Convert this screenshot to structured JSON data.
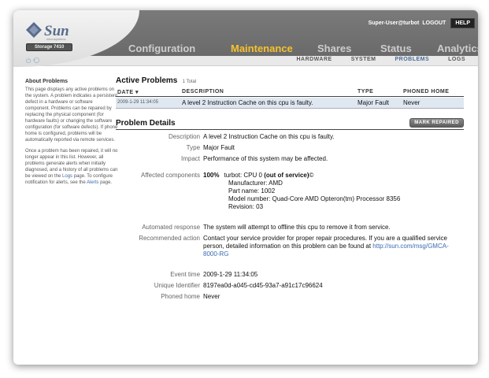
{
  "brand": {
    "logo_text": "Sun",
    "logo_subtext": "microsystems",
    "product": "Storage 7410"
  },
  "header": {
    "user": "Super-User@turbot",
    "logout": "LOGOUT",
    "help": "HELP",
    "status_icons": "⏻ ⟲"
  },
  "main_tabs": [
    {
      "label": "Configuration",
      "active": false
    },
    {
      "label": "Maintenance",
      "active": true
    },
    {
      "label": "Shares",
      "active": false
    },
    {
      "label": "Status",
      "active": false
    },
    {
      "label": "Analytics",
      "active": false
    }
  ],
  "sub_tabs": [
    {
      "label": "HARDWARE",
      "active": false
    },
    {
      "label": "SYSTEM",
      "active": false
    },
    {
      "label": "PROBLEMS",
      "active": true
    },
    {
      "label": "LOGS",
      "active": false
    }
  ],
  "sidebar": {
    "title": "About Problems",
    "p1": "This page displays any active problems on the system. A problem indicates a persistent defect in a hardware or software component. Problems can be repaired by replacing the physical component (for hardware faults) or changing the software configuration (for software defects). If phone home is configured, problems will be automatically reported via remote services.",
    "p2_a": "Once a problem has been repaired, it will no longer appear in this list. However, all problems generate alerts when initially diagnosed, and a history of all problems can be viewed on the",
    "p2_logs": "Logs",
    "p2_b": "page. To configure notification for alerts, see the",
    "p2_alerts": "Alerts",
    "p2_c": "page."
  },
  "active_problems": {
    "title": "Active Problems",
    "total": "1 Total",
    "columns": {
      "date": "DATE ▾",
      "description": "DESCRIPTION",
      "type": "TYPE",
      "phoned_home": "PHONED HOME"
    },
    "rows": [
      {
        "date": "2009-1-29 11:34:05",
        "description": "A level 2 Instruction Cache on this cpu is faulty.",
        "type": "Major Fault",
        "phoned_home": "Never"
      }
    ]
  },
  "details": {
    "title": "Problem Details",
    "mark_repaired": "MARK REPAIRED",
    "labels": {
      "description": "Description",
      "type": "Type",
      "impact": "Impact",
      "affected": "Affected components",
      "automated": "Automated response",
      "recommended": "Recommended action",
      "event_time": "Event time",
      "uid": "Unique Identifier",
      "phoned_home": "Phoned home"
    },
    "description": "A level 2 Instruction Cache on this cpu is faulty.",
    "type": "Major Fault",
    "impact": "Performance of this system may be affected.",
    "affected": {
      "percent": "100%",
      "component": "turbot: CPU 0",
      "status": "(out of service)",
      "manufacturer": "Manufacturer: AMD",
      "part_name": "Part name: 1002",
      "model": "Model number: Quad-Core AMD Opteron(tm) Processor 8356",
      "revision": "Revision: 03"
    },
    "automated": "The system will attempt to offline this cpu to remove it from service.",
    "recommended_text": "Contact your service provider for proper repair procedures. If you are a qualified service person, detailed information on this problem can be found at",
    "recommended_link": "http://sun.com/msg/GMCA-8000-RG",
    "event_time": "2009-1-29 11:34:05",
    "uid": "8197ea0d-a045-cd45-93a7-a91c17c96624",
    "phoned_home": "Never"
  }
}
